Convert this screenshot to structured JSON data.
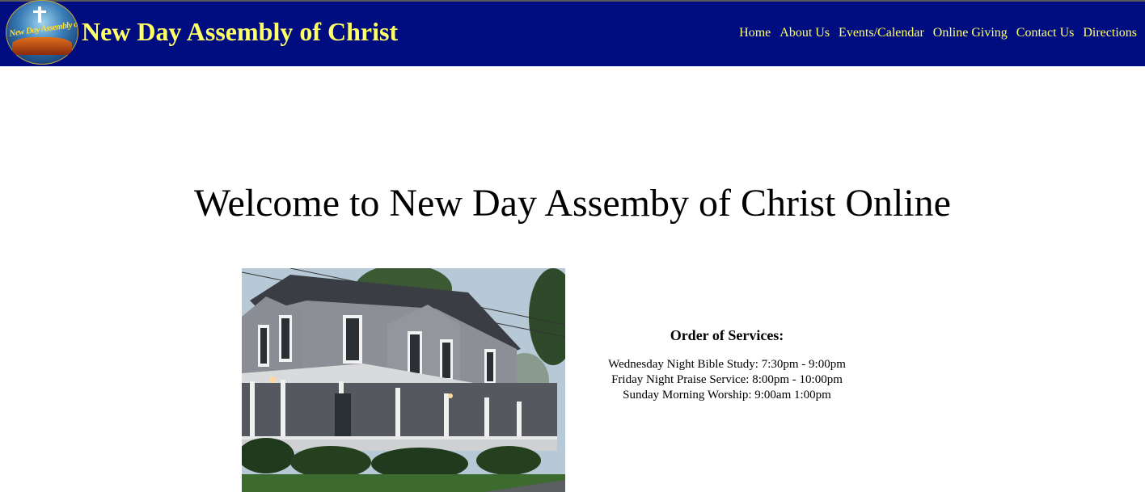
{
  "header": {
    "site_title": "New Day Assembly of Christ",
    "logo_text": "New Day Assembly of Christ",
    "background": "#000d80",
    "text_color": "#ffff66"
  },
  "nav": {
    "items": [
      {
        "label": "Home"
      },
      {
        "label": "About Us"
      },
      {
        "label": "Events/Calendar"
      },
      {
        "label": "Online Giving"
      },
      {
        "label": "Contact Us"
      },
      {
        "label": "Directions"
      }
    ]
  },
  "main": {
    "welcome": "Welcome to New Day Assemby of Christ Online",
    "services": {
      "title": "Order of Services:",
      "lines": [
        "Wednesday Night Bible Study: 7:30pm - 9:00pm",
        "Friday Night Praise Service: 8:00pm - 10:00pm",
        "Sunday Morning Worship: 9:00am 1:00pm"
      ]
    }
  }
}
